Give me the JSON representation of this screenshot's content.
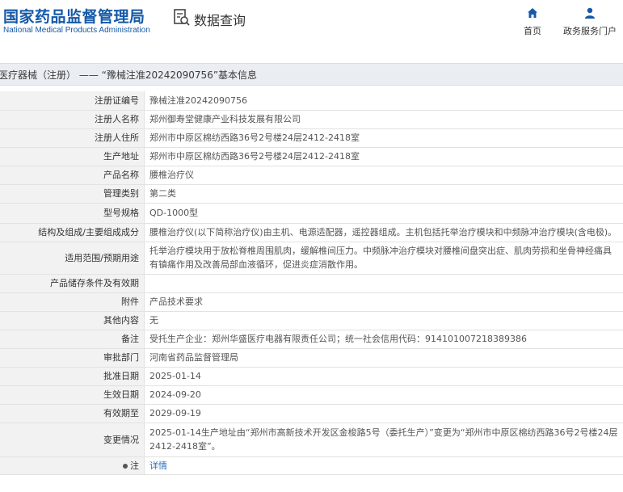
{
  "site": {
    "name_cn": "国家药品监督管理局",
    "name_en": "National Medical Products Administration"
  },
  "query": {
    "label": "数据查询",
    "icon": "search-document-icon"
  },
  "nav": {
    "home": {
      "label": "首页",
      "icon": "home-icon"
    },
    "service": {
      "label": "政务服务门户",
      "icon": "user-icon"
    }
  },
  "colors": {
    "brand": "#1559a8",
    "titlebar_bg": "#eaeef3",
    "label_bg": "#f2f2f2",
    "link": "#2a6fb8"
  },
  "page_title": "医疗器械（注册） —— “豫械注准20242090756”基本信息",
  "rows": [
    {
      "key": "注册证编号",
      "value": "豫械注准20242090756"
    },
    {
      "key": "注册人名称",
      "value": "郑州御寿堂健康产业科技发展有限公司"
    },
    {
      "key": "注册人住所",
      "value": "郑州市中原区棉纺西路36号2号楼24层2412-2418室"
    },
    {
      "key": "生产地址",
      "value": "郑州市中原区棉纺西路36号2号楼24层2412-2418室"
    },
    {
      "key": "产品名称",
      "value": "腰椎治疗仪"
    },
    {
      "key": "管理类别",
      "value": "第二类"
    },
    {
      "key": "型号规格",
      "value": "QD-1000型"
    },
    {
      "key": "结构及组成/主要组成成分",
      "value": "腰椎治疗仪(以下简称治疗仪)由主机、电源适配器，遥控器组成。主机包括托举治疗模块和中频脉冲治疗模块(含电极)。"
    },
    {
      "key": "适用范围/预期用途",
      "value": "托举治疗模块用于放松脊椎周围肌肉，缓解椎间压力。中频脉冲治疗模块对腰椎间盘突出症、肌肉劳损和坐骨神经痛具有镇痛作用及改善局部血液循环，促进炎症消散作用。"
    },
    {
      "key": "产品储存条件及有效期",
      "value": ""
    },
    {
      "key": "附件",
      "value": "产品技术要求"
    },
    {
      "key": "其他内容",
      "value": "无"
    },
    {
      "key": "备注",
      "value": "受托生产企业：郑州华盛医疗电器有限责任公司；统一社会信用代码：914101007218389386"
    },
    {
      "key": "审批部门",
      "value": "河南省药品监督管理局"
    },
    {
      "key": "批准日期",
      "value": "2025-01-14"
    },
    {
      "key": "生效日期",
      "value": "2024-09-20"
    },
    {
      "key": "有效期至",
      "value": "2029-09-19"
    },
    {
      "key": "变更情况",
      "value": "2025-01-14生产地址由“郑州市高新技术开发区金梭路5号（委托生产）”变更为“郑州市中原区棉纺西路36号2号楼24层2412-2418室”。"
    },
    {
      "key": "注",
      "value": "详情",
      "key_icon": "bullet-icon"
    }
  ]
}
